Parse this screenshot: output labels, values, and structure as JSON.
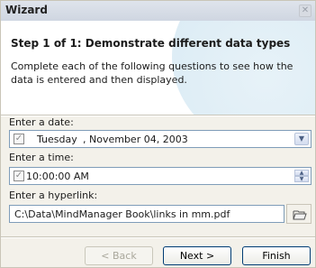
{
  "window": {
    "title": "Wizard"
  },
  "header": {
    "step_title": "Step 1 of 1: Demonstrate different data types",
    "description": "Complete each of the following questions to see how the data is entered and then displayed."
  },
  "date_field": {
    "label": "Enter a date:",
    "weekday": "Tuesday",
    "date": ", November 04, 2003",
    "checked": true
  },
  "time_field": {
    "label": "Enter a time:",
    "value": "10:00:00 AM",
    "checked": true
  },
  "hyperlink_field": {
    "label": "Enter a hyperlink:",
    "value": "C:\\Data\\MindManager Book\\links in mm.pdf"
  },
  "buttons": {
    "back": "< Back",
    "next": "Next >",
    "finish": "Finish"
  },
  "icons": {
    "close": "close-icon",
    "dropdown": "chevron-down-icon",
    "spin_up": "spin-up-icon",
    "spin_down": "spin-down-icon",
    "browse": "folder-open-icon",
    "checkbox": "checkbox-checked-icon"
  }
}
